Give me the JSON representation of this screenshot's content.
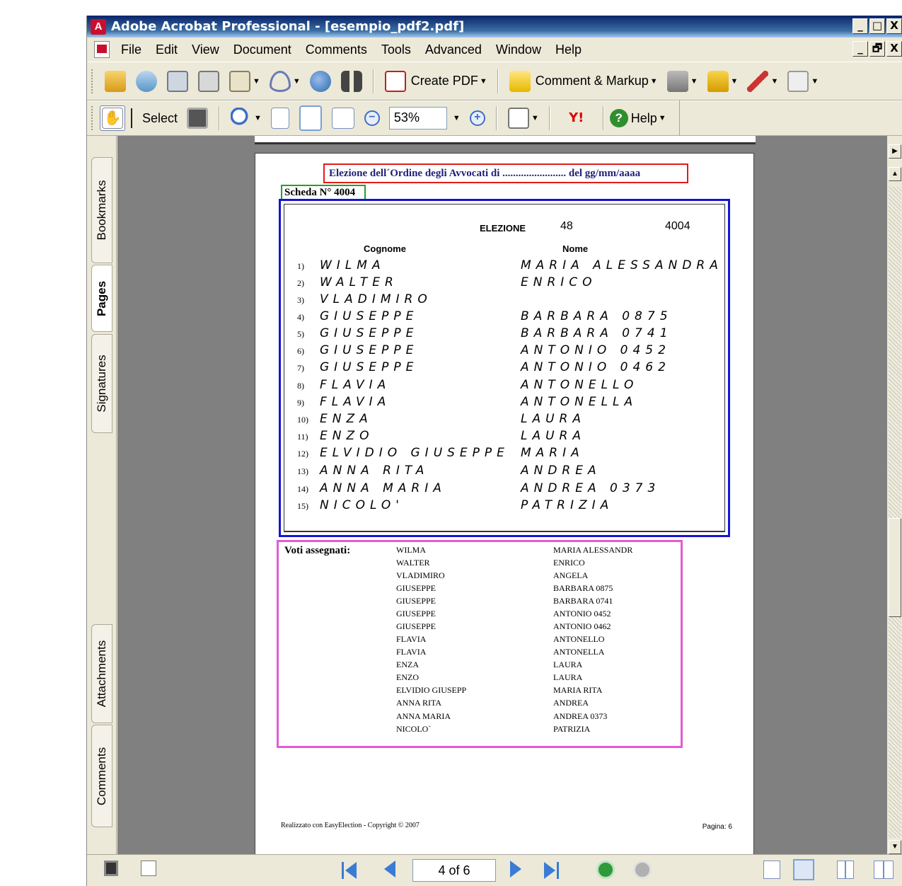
{
  "window": {
    "title": "Adobe Acrobat Professional - [esempio_pdf2.pdf]",
    "controls": [
      "_",
      "□",
      "X"
    ],
    "mdi_controls": [
      "_",
      "🗗",
      "X"
    ]
  },
  "menu": {
    "items": [
      "File",
      "Edit",
      "View",
      "Document",
      "Comments",
      "Tools",
      "Advanced",
      "Window",
      "Help"
    ]
  },
  "toolbar1": {
    "create_pdf_label": "Create PDF",
    "comment_markup_label": "Comment & Markup"
  },
  "toolbar2": {
    "select_label": "Select",
    "zoom_value": "53%",
    "yahoo_label": "Y!",
    "help_label": "Help"
  },
  "nav_tabs": {
    "bookmarks": "Bookmarks",
    "pages": "Pages",
    "signatures": "Signatures",
    "attachments": "Attachments",
    "comments": "Comments"
  },
  "document": {
    "header_title": "Elezione dell´Ordine degli Avvocati di  ........................  del gg/mm/aaaa",
    "scheda": "Scheda N° 4004",
    "scan": {
      "elezione_label": "ELEZIONE",
      "elezione_num": "48",
      "elezione_id": "4004",
      "col_cognome": "Cognome",
      "col_nome": "Nome",
      "rows": [
        {
          "n": "1)",
          "surname": "WILMA",
          "name": "MARIA ALESSANDRA"
        },
        {
          "n": "2)",
          "surname": "WALTER",
          "name": "ENRICO"
        },
        {
          "n": "3)",
          "surname": "VLADIMIRO",
          "name": ""
        },
        {
          "n": "4)",
          "surname": "GIUSEPPE",
          "name": "BARBARA 0875"
        },
        {
          "n": "5)",
          "surname": "GIUSEPPE",
          "name": "BARBARA 0741"
        },
        {
          "n": "6)",
          "surname": "GIUSEPPE",
          "name": "ANTONIO 0452"
        },
        {
          "n": "7)",
          "surname": "GIUSEPPE",
          "name": "ANTONIO 0462"
        },
        {
          "n": "8)",
          "surname": "FLAVIA",
          "name": "ANTONELLO"
        },
        {
          "n": "9)",
          "surname": "FLAVIA",
          "name": "ANTONELLA"
        },
        {
          "n": "10)",
          "surname": "ENZA",
          "name": "LAURA"
        },
        {
          "n": "11)",
          "surname": "ENZO",
          "name": "LAURA"
        },
        {
          "n": "12)",
          "surname": "ELVIDIO GIUSEPPE",
          "name": "MARIA"
        },
        {
          "n": "13)",
          "surname": "ANNA RITA",
          "name": "ANDREA"
        },
        {
          "n": "14)",
          "surname": "ANNA MARIA",
          "name": "ANDREA 0373"
        },
        {
          "n": "15)",
          "surname": "NICOLO'",
          "name": "PATRIZIA"
        }
      ]
    },
    "voti_label": "Voti assegnati:",
    "voti": [
      {
        "surname": "WILMA",
        "name": "MARIA ALESSANDR"
      },
      {
        "surname": "WALTER",
        "name": "ENRICO"
      },
      {
        "surname": "VLADIMIRO",
        "name": "ANGELA"
      },
      {
        "surname": "GIUSEPPE",
        "name": "BARBARA 0875"
      },
      {
        "surname": "GIUSEPPE",
        "name": "BARBARA 0741"
      },
      {
        "surname": "GIUSEPPE",
        "name": "ANTONIO 0452"
      },
      {
        "surname": "GIUSEPPE",
        "name": "ANTONIO 0462"
      },
      {
        "surname": "FLAVIA",
        "name": "ANTONELLO"
      },
      {
        "surname": "FLAVIA",
        "name": "ANTONELLA"
      },
      {
        "surname": "ENZA",
        "name": "LAURA"
      },
      {
        "surname": "ENZO",
        "name": "LAURA"
      },
      {
        "surname": "ELVIDIO GIUSEPP",
        "name": "MARIA RITA"
      },
      {
        "surname": "ANNA RITA",
        "name": "ANDREA"
      },
      {
        "surname": "ANNA MARIA",
        "name": "ANDREA 0373"
      },
      {
        "surname": "NICOLO`",
        "name": "PATRIZIA"
      }
    ],
    "footer_left": "Realizzato con EasyElection - Copyright © 2007",
    "footer_right": "Pagina: 6"
  },
  "statusbar": {
    "page_indicator": "4 of 6"
  }
}
